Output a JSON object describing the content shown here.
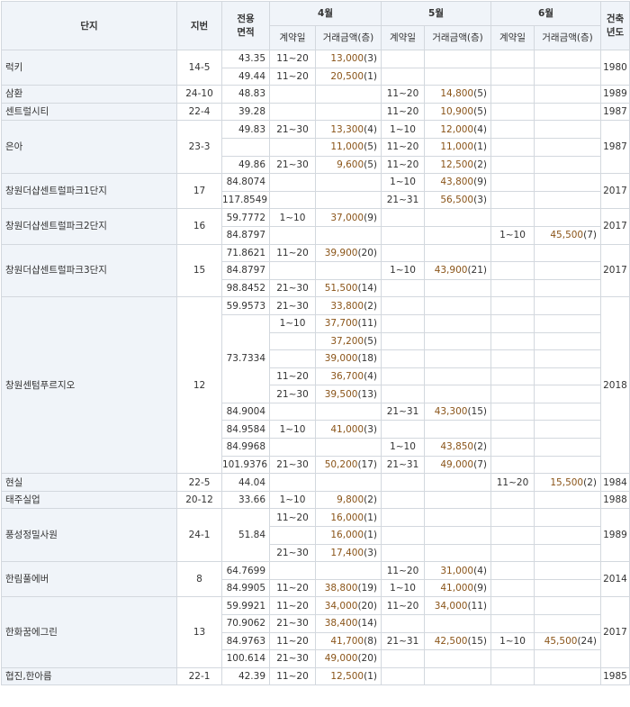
{
  "headers": {
    "complex": "단지",
    "lot": "지번",
    "area": "전용\n면적",
    "built": "건축\n년도",
    "months": [
      "4월",
      "5월",
      "6월"
    ],
    "contract": "계약일",
    "amount": "거래금액(층)"
  },
  "groups": [
    {
      "name": "럭키",
      "lot": "14-5",
      "year": "1980",
      "rows": [
        {
          "area": "43.35",
          "m": [
            {
              "d": "11~20",
              "a": "13,000",
              "f": "(3)"
            },
            null,
            null
          ]
        },
        {
          "area": "49.44",
          "m": [
            {
              "d": "11~20",
              "a": "20,500",
              "f": "(1)"
            },
            null,
            null
          ]
        }
      ]
    },
    {
      "name": "삼환",
      "lot": "24-10",
      "year": "1989",
      "rows": [
        {
          "area": "48.83",
          "m": [
            null,
            {
              "d": "11~20",
              "a": "14,800",
              "f": "(5)"
            },
            null
          ]
        }
      ]
    },
    {
      "name": "센트럴시티",
      "lot": "22-4",
      "year": "1987",
      "rows": [
        {
          "area": "39.28",
          "m": [
            null,
            {
              "d": "11~20",
              "a": "10,900",
              "f": "(5)"
            },
            null
          ]
        }
      ]
    },
    {
      "name": "은아",
      "lot": "23-3",
      "year": "1987",
      "rows": [
        {
          "area": "49.83",
          "m": [
            {
              "d": "21~30",
              "a": "13,300",
              "f": "(4)"
            },
            {
              "d": "1~10",
              "a": "12,000",
              "f": "(4)"
            },
            null
          ]
        },
        {
          "area": "",
          "m": [
            {
              "d": "",
              "a": "11,000",
              "f": "(5)"
            },
            {
              "d": "11~20",
              "a": "11,000",
              "f": "(1)"
            },
            null
          ]
        },
        {
          "area": "49.86",
          "m": [
            {
              "d": "21~30",
              "a": "9,600",
              "f": "(5)"
            },
            {
              "d": "11~20",
              "a": "12,500",
              "f": "(2)"
            },
            null
          ]
        }
      ]
    },
    {
      "name": "창원더샵센트럴파크1단지",
      "lot": "17",
      "year": "2017",
      "rows": [
        {
          "area": "84.8074",
          "m": [
            null,
            {
              "d": "1~10",
              "a": "43,800",
              "f": "(9)"
            },
            null
          ]
        },
        {
          "area": "117.8549",
          "m": [
            null,
            {
              "d": "21~31",
              "a": "56,500",
              "f": "(3)"
            },
            null
          ]
        }
      ]
    },
    {
      "name": "창원더샵센트럴파크2단지",
      "lot": "16",
      "year": "2017",
      "rows": [
        {
          "area": "59.7772",
          "m": [
            {
              "d": "1~10",
              "a": "37,000",
              "f": "(9)"
            },
            null,
            null
          ]
        },
        {
          "area": "84.8797",
          "m": [
            null,
            null,
            {
              "d": "1~10",
              "a": "45,500",
              "f": "(7)"
            }
          ]
        }
      ]
    },
    {
      "name": "창원더샵센트럴파크3단지",
      "lot": "15",
      "year": "2017",
      "rows": [
        {
          "area": "71.8621",
          "m": [
            {
              "d": "11~20",
              "a": "39,900",
              "f": "(20)"
            },
            null,
            null
          ]
        },
        {
          "area": "84.8797",
          "m": [
            null,
            {
              "d": "1~10",
              "a": "43,900",
              "f": "(21)"
            },
            null
          ]
        },
        {
          "area": "98.8452",
          "m": [
            {
              "d": "21~30",
              "a": "51,500",
              "f": "(14)"
            },
            null,
            null
          ]
        }
      ]
    },
    {
      "name": "창원센텀푸르지오",
      "lot": "12",
      "year": "2018",
      "rows": [
        {
          "area": "59.9573",
          "m": [
            {
              "d": "21~30",
              "a": "33,800",
              "f": "(2)"
            },
            null,
            null
          ]
        },
        {
          "area": "73.7334",
          "span": 5,
          "m": [
            {
              "d": "1~10",
              "a": "37,700",
              "f": "(11)"
            },
            null,
            null
          ]
        },
        {
          "area": null,
          "m": [
            {
              "d": "",
              "a": "37,200",
              "f": "(5)"
            },
            null,
            null
          ]
        },
        {
          "area": null,
          "m": [
            {
              "d": "",
              "a": "39,000",
              "f": "(18)"
            },
            null,
            null
          ]
        },
        {
          "area": null,
          "m": [
            {
              "d": "11~20",
              "a": "36,700",
              "f": "(4)"
            },
            null,
            null
          ]
        },
        {
          "area": null,
          "m": [
            {
              "d": "21~30",
              "a": "39,500",
              "f": "(13)"
            },
            null,
            null
          ]
        },
        {
          "area": "84.9004",
          "m": [
            null,
            {
              "d": "21~31",
              "a": "43,300",
              "f": "(15)"
            },
            null
          ]
        },
        {
          "area": "84.9584",
          "m": [
            {
              "d": "1~10",
              "a": "41,000",
              "f": "(3)"
            },
            null,
            null
          ]
        },
        {
          "area": "84.9968",
          "m": [
            null,
            {
              "d": "1~10",
              "a": "43,850",
              "f": "(2)"
            },
            null
          ]
        },
        {
          "area": "101.9376",
          "m": [
            {
              "d": "21~30",
              "a": "50,200",
              "f": "(17)"
            },
            {
              "d": "21~31",
              "a": "49,000",
              "f": "(7)"
            },
            null
          ]
        }
      ]
    },
    {
      "name": "현실",
      "lot": "22-5",
      "year": "1984",
      "rows": [
        {
          "area": "44.04",
          "m": [
            null,
            null,
            {
              "d": "11~20",
              "a": "15,500",
              "f": "(2)"
            }
          ]
        }
      ]
    },
    {
      "name": "태주실업",
      "lot": "20-12",
      "year": "1988",
      "rows": [
        {
          "area": "33.66",
          "m": [
            {
              "d": "1~10",
              "a": "9,800",
              "f": "(2)"
            },
            null,
            null
          ]
        }
      ]
    },
    {
      "name": "풍성정밀사원",
      "lot": "24-1",
      "year": "1989",
      "rows": [
        {
          "area": "51.84",
          "span": 3,
          "m": [
            {
              "d": "11~20",
              "a": "16,000",
              "f": "(1)"
            },
            null,
            null
          ]
        },
        {
          "area": null,
          "m": [
            {
              "d": "",
              "a": "16,000",
              "f": "(1)"
            },
            null,
            null
          ]
        },
        {
          "area": null,
          "m": [
            {
              "d": "21~30",
              "a": "17,400",
              "f": "(3)"
            },
            null,
            null
          ]
        }
      ]
    },
    {
      "name": "한림풀에버",
      "lot": "8",
      "year": "2014",
      "rows": [
        {
          "area": "64.7699",
          "m": [
            null,
            {
              "d": "11~20",
              "a": "31,000",
              "f": "(4)"
            },
            null
          ]
        },
        {
          "area": "84.9905",
          "m": [
            {
              "d": "11~20",
              "a": "38,800",
              "f": "(19)"
            },
            {
              "d": "1~10",
              "a": "41,000",
              "f": "(9)"
            },
            null
          ]
        }
      ]
    },
    {
      "name": "한화꿈에그린",
      "lot": "13",
      "year": "2017",
      "rows": [
        {
          "area": "59.9921",
          "m": [
            {
              "d": "11~20",
              "a": "34,000",
              "f": "(20)"
            },
            {
              "d": "11~20",
              "a": "34,000",
              "f": "(11)"
            },
            null
          ]
        },
        {
          "area": "70.9062",
          "m": [
            {
              "d": "21~30",
              "a": "38,400",
              "f": "(14)"
            },
            null,
            null
          ]
        },
        {
          "area": "84.9763",
          "m": [
            {
              "d": "11~20",
              "a": "41,700",
              "f": "(8)"
            },
            {
              "d": "21~31",
              "a": "42,500",
              "f": "(15)"
            },
            {
              "d": "1~10",
              "a": "45,500",
              "f": "(24)"
            }
          ]
        },
        {
          "area": "100.614",
          "m": [
            {
              "d": "21~30",
              "a": "49,000",
              "f": "(20)"
            },
            null,
            null
          ]
        }
      ]
    },
    {
      "name": "협진,한아름",
      "lot": "22-1",
      "year": "1985",
      "rows": [
        {
          "area": "42.39",
          "m": [
            {
              "d": "11~20",
              "a": "12,500",
              "f": "(1)"
            },
            null,
            null
          ]
        }
      ]
    }
  ]
}
